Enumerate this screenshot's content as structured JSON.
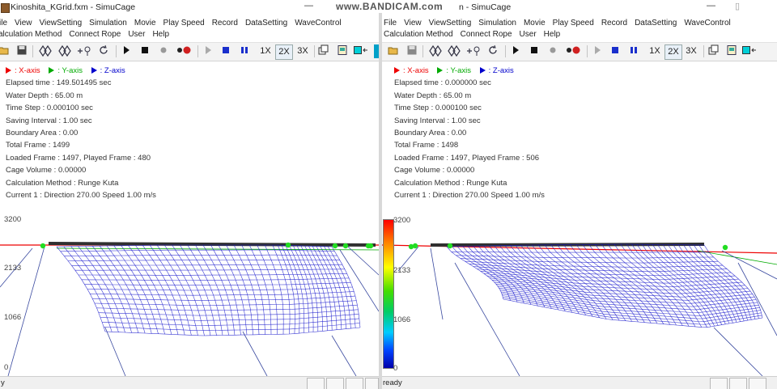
{
  "watermark": "www.BANDICAM.com",
  "left_window": {
    "title": "Kinoshita_KGrid.fxm - SimuCage",
    "minimize": "—",
    "menu_row1": [
      "ile",
      "View",
      "ViewSetting",
      "Simulation",
      "Movie",
      "Play Speed",
      "Record",
      "DataSetting",
      "WaveControl"
    ],
    "menu_row2": [
      "alculation Method",
      "Connect Rope",
      "User",
      "Help"
    ],
    "legend": [
      "X-axis",
      "Y-axis",
      "Z-axis"
    ],
    "info": [
      "Elapsed time : 149.501495 sec",
      "Water Depth : 65.00 m",
      "Time Step : 0.000100 sec",
      "Saving Interval : 1.00 sec",
      "Boundary Area : 0.00",
      "Total Frame : 1499",
      "Loaded Frame : 1497, Played Frame : 480",
      "Cage Volume : 0.00000",
      "Calculation Method : Runge Kuta",
      "Current 1 : Direction 270.00 Speed 1.00 m/s"
    ],
    "y_ticks": [
      "3200",
      "2133",
      "1066",
      "0"
    ],
    "status": "y"
  },
  "right_window": {
    "title": "n - SimuCage",
    "minimize": "—",
    "maximize": "▯",
    "menu_row1": [
      "File",
      "View",
      "ViewSetting",
      "Simulation",
      "Movie",
      "Play Speed",
      "Record",
      "DataSetting",
      "WaveControl"
    ],
    "menu_row2": [
      "Calculation Method",
      "Connect Rope",
      "User",
      "Help"
    ],
    "legend": [
      "X-axis",
      "Y-axis",
      "Z-axis"
    ],
    "info": [
      "Elapsed time : 0.000000 sec",
      "Water Depth : 65.00 m",
      "Time Step : 0.000100 sec",
      "Saving Interval : 1.00 sec",
      "Boundary Area : 0.00",
      "Total Frame : 1498",
      "Loaded Frame : 1497, Played Frame : 506",
      "Cage Volume : 0.00000",
      "Calculation Method : Runge Kuta",
      "Current 1 : Direction 270.00 Speed 1.00 m/s"
    ],
    "y_ticks": [
      "3200",
      "2133",
      "1066",
      "0"
    ],
    "status": "ready"
  },
  "toolbar": {
    "speed_1x": "1X",
    "speed_2x": "2X",
    "speed_3x": "3X",
    "icons": [
      "open-icon",
      "save-icon",
      "rotate-x-icon",
      "rotate-y-icon",
      "move-icon",
      "rotate-icon",
      "play-icon",
      "stop-icon",
      "record-dot-icon",
      "record-icon",
      "step-icon",
      "pause-icon",
      "view-icon",
      "print-icon",
      "color-icon"
    ]
  },
  "colors": {
    "x_axis": "#ee0000",
    "y_axis": "#00aa00",
    "z_axis": "#0000cc",
    "net_mesh": "#1a1acc",
    "rope_node": "#22dd22",
    "float_frame": "#303030"
  }
}
